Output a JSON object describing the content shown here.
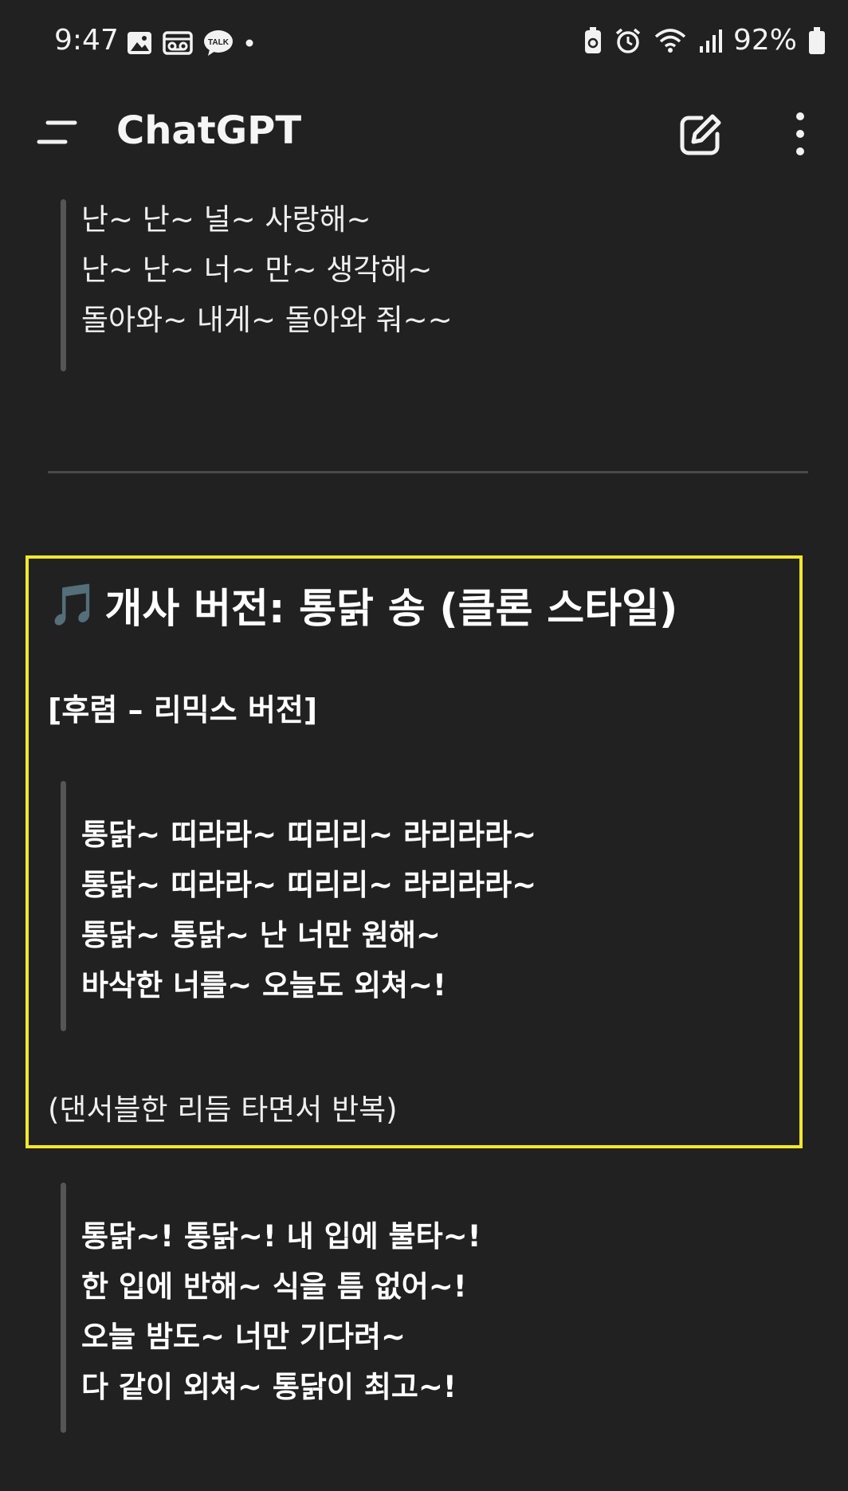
{
  "status_bar": {
    "time": "9:47",
    "battery": "92%",
    "left_icons": [
      "image-icon",
      "voicemail-icon",
      "kakaotalk-icon",
      "dot-icon"
    ],
    "kakao_label": "TALK",
    "right_icons": [
      "battery-saver-icon",
      "alarm-icon",
      "wifi-icon",
      "signal-icon",
      "battery-icon"
    ]
  },
  "app_bar": {
    "title": "ChatGPT",
    "icons": [
      "menu-icon",
      "edit-icon",
      "more-icon"
    ]
  },
  "blocks": {
    "verse_top": [
      "난~ 난~ 널~ 사랑해~",
      "난~ 난~ 너~ 만~ 생각해~",
      "돌아와~ 내게~ 돌아와 줘~~"
    ],
    "section_title_emoji": "🎵",
    "section_title": "개사 버전: 통닭 송 (클론 스타일)",
    "chorus_heading": "[후렴 – 리믹스 버전]",
    "chorus": [
      "통닭~ 띠라라~ 띠리리~ 라리라라~",
      "통닭~ 띠라라~ 띠리리~ 라리라라~",
      "통닭~ 통닭~ 난 너만 원해~",
      "바삭한 너를~ 오늘도 외쳐~!"
    ],
    "chorus_note": "(댄서블한 리듬 타면서 반복)",
    "verse_bottom": [
      "통닭~! 통닭~! 내 입에 불타~!",
      "한 입에 반해~ 식을 틈 없어~!",
      "오늘 밤도~ 너만 기다려~",
      "다 같이 외쳐~ 통닭이 최고~!"
    ]
  },
  "colors": {
    "background": "#212121",
    "highlight": "#f3e82a",
    "quote_bar": "#555555"
  }
}
